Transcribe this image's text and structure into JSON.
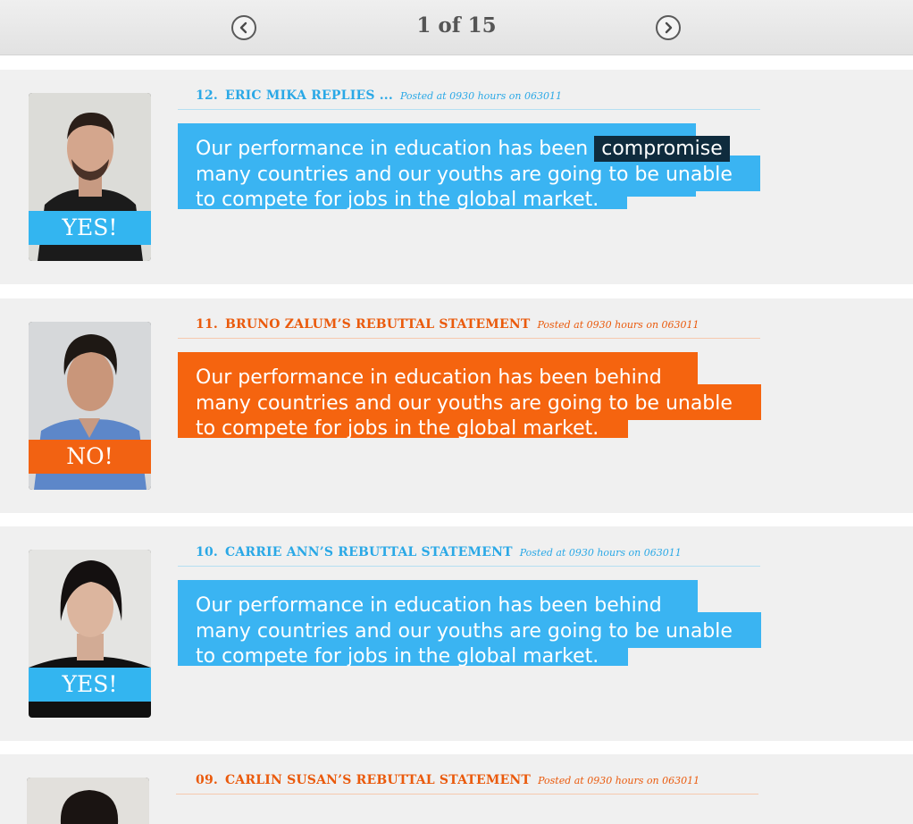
{
  "pager": {
    "prev_icon": "chevron-left-icon",
    "next_icon": "chevron-right-icon",
    "count": "1 of 15"
  },
  "entries": [
    {
      "number": "12.",
      "title": "ERIC MIKA REPLIES ...",
      "posted": "Posted at 0930 hours on 063011",
      "vote": "YES!",
      "color": "#3ab4f2",
      "quote": {
        "line1_pre": "Our performance in education has been",
        "line1_highlight": "compromise",
        "line2": "many countries and our youths are going to be unable",
        "line3": "to compete for jobs in the global market."
      }
    },
    {
      "number": "11.",
      "title": "BRUNO ZALUM’S REBUTTAL STATEMENT",
      "posted": "Posted at 0930 hours on 063011",
      "vote": "NO!",
      "color": "#f5640f",
      "quote": {
        "line1": "Our performance in education has been behind",
        "line2": "many countries and our youths are going to be unable",
        "line3": "to compete for jobs in the global market."
      }
    },
    {
      "number": "10.",
      "title": "CARRIE ANN’S REBUTTAL STATEMENT",
      "posted": "Posted at 0930 hours on 063011",
      "vote": "YES!",
      "color": "#3ab4f2",
      "quote": {
        "line1": "Our performance in education has been behind",
        "line2": "many countries and our youths are going to be unable",
        "line3": "to compete for jobs in the global market."
      }
    },
    {
      "number": "09.",
      "title": "CARLIN SUSAN’S REBUTTAL STATEMENT",
      "posted": "Posted at 0930 hours on 063011",
      "color": "#f5640f"
    }
  ]
}
